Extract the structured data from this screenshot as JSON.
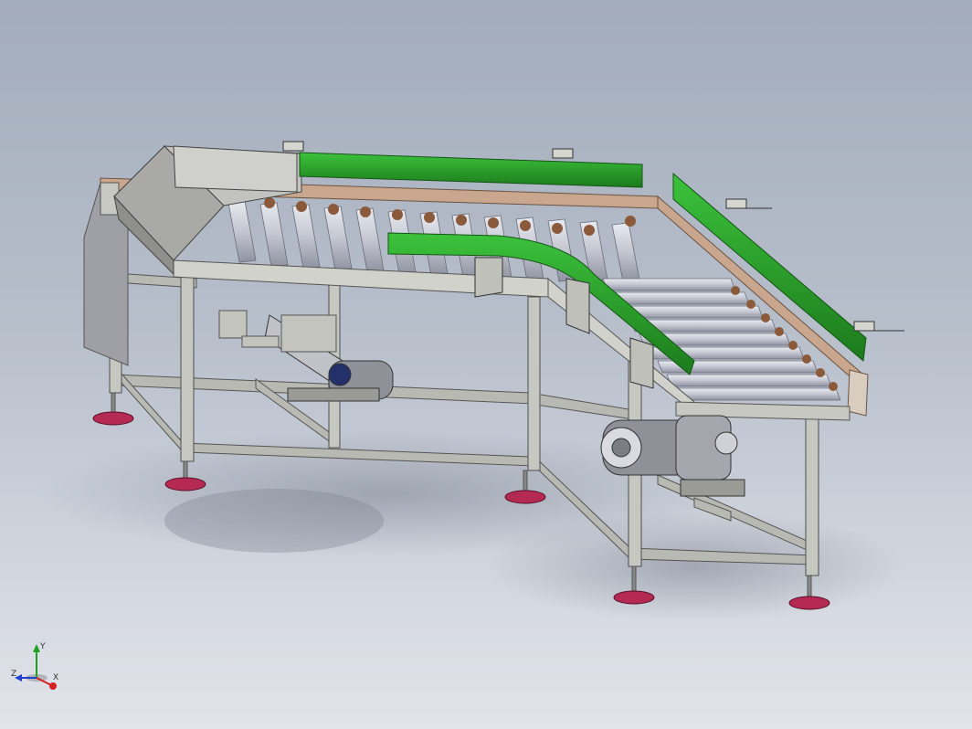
{
  "view": {
    "background_top": "#a3acbb",
    "background_bottom": "#e1e4ea"
  },
  "model": {
    "frame_color": "#b6b6b0",
    "guide_rail_color": "#2fa32f",
    "roller_color": "#c9ccd6",
    "foot_color": "#b52a52",
    "side_channel_color": "#c9a68e",
    "motor_color": "#8e9198"
  },
  "triad": {
    "x_label": "X",
    "y_label": "Y",
    "z_label": "Z",
    "x_color": "#d42020",
    "y_color": "#20a020",
    "z_color": "#2040d0"
  }
}
